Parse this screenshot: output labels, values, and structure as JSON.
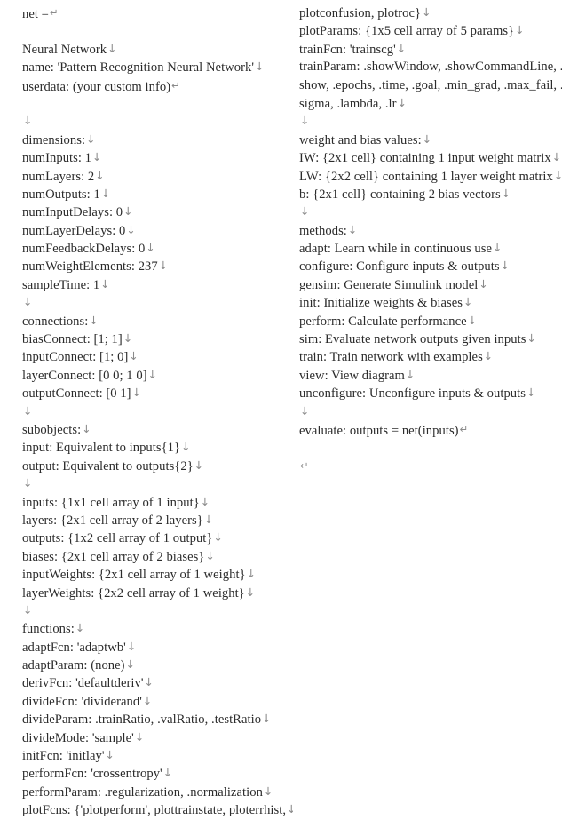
{
  "document": {
    "kind": "matlab-network-object-printout",
    "background_color": "#ffffff",
    "text_color": "#2b2b2b",
    "mark_color": "#8a8a8a",
    "marks": {
      "line_break": "↓",
      "paragraph": "↵"
    },
    "left_column": [
      {
        "text": "net =",
        "mark": "paragraph"
      },
      {
        "text": "",
        "mark": "none"
      },
      {
        "text": "Neural Network",
        "mark": "break"
      },
      {
        "text": "name: 'Pattern Recognition Neural Network'",
        "mark": "break"
      },
      {
        "text": "userdata: (your custom info)",
        "mark": "paragraph"
      },
      {
        "text": "",
        "mark": "none"
      },
      {
        "text": "",
        "mark": "break"
      },
      {
        "text": "dimensions:",
        "mark": "break"
      },
      {
        "text": "numInputs: 1",
        "mark": "break"
      },
      {
        "text": "numLayers: 2",
        "mark": "break"
      },
      {
        "text": "numOutputs: 1",
        "mark": "break"
      },
      {
        "text": "numInputDelays: 0",
        "mark": "break"
      },
      {
        "text": "numLayerDelays: 0",
        "mark": "break"
      },
      {
        "text": "numFeedbackDelays: 0",
        "mark": "break"
      },
      {
        "text": "numWeightElements: 237",
        "mark": "break"
      },
      {
        "text": "sampleTime: 1",
        "mark": "break"
      },
      {
        "text": "",
        "mark": "break"
      },
      {
        "text": "connections:",
        "mark": "break"
      },
      {
        "text": "biasConnect: [1; 1]",
        "mark": "break"
      },
      {
        "text": "inputConnect: [1; 0]",
        "mark": "break"
      },
      {
        "text": "layerConnect: [0 0; 1 0]",
        "mark": "break"
      },
      {
        "text": "outputConnect: [0 1]",
        "mark": "break"
      },
      {
        "text": "",
        "mark": "break"
      },
      {
        "text": "subobjects:",
        "mark": "break"
      },
      {
        "text": "input: Equivalent to inputs{1}",
        "mark": "break"
      },
      {
        "text": "output: Equivalent to outputs{2}",
        "mark": "break"
      },
      {
        "text": "",
        "mark": "break"
      },
      {
        "text": "inputs: {1x1 cell array of 1 input}",
        "mark": "break"
      },
      {
        "text": "layers: {2x1 cell array of 2 layers}",
        "mark": "break"
      },
      {
        "text": "outputs: {1x2 cell array of 1 output}",
        "mark": "break"
      },
      {
        "text": "biases: {2x1 cell array of 2 biases}",
        "mark": "break"
      },
      {
        "text": "inputWeights: {2x1 cell array of 1 weight}",
        "mark": "break"
      },
      {
        "text": "layerWeights: {2x2 cell array of 1 weight}",
        "mark": "break"
      },
      {
        "text": "",
        "mark": "break"
      },
      {
        "text": "functions:",
        "mark": "break"
      },
      {
        "text": "adaptFcn: 'adaptwb'",
        "mark": "break"
      },
      {
        "text": "adaptParam: (none)",
        "mark": "break"
      },
      {
        "text": "derivFcn: 'defaultderiv'",
        "mark": "break"
      },
      {
        "text": "divideFcn: 'dividerand'",
        "mark": "break"
      },
      {
        "text": "divideParam: .trainRatio, .valRatio, .testRatio",
        "mark": "break"
      },
      {
        "text": "divideMode: 'sample'",
        "mark": "break"
      },
      {
        "text": "initFcn: 'initlay'",
        "mark": "break"
      },
      {
        "text": "performFcn: 'crossentropy'",
        "mark": "break"
      },
      {
        "text": "performParam: .regularization, .normalization",
        "mark": "break"
      },
      {
        "text": "plotFcns: {'plotperform', plottrainstate, ploterrhist,",
        "mark": "break"
      }
    ],
    "right_column": [
      {
        "text": "plotconfusion, plotroc}",
        "mark": "break"
      },
      {
        "text": "plotParams: {1x5 cell array of 5 params}",
        "mark": "break"
      },
      {
        "text": "trainFcn: 'trainscg'",
        "mark": "break"
      },
      {
        "text": "trainParam: .showWindow, .showCommandLine, .",
        "mark": "none"
      },
      {
        "text": "show, .epochs, .time, .goal, .min_grad, .max_fail, .",
        "mark": "none"
      },
      {
        "text": "sigma, .lambda, .lr",
        "mark": "break"
      },
      {
        "text": "",
        "mark": "break"
      },
      {
        "text": "weight and bias values:",
        "mark": "break"
      },
      {
        "text": "IW: {2x1 cell} containing 1 input weight matrix",
        "mark": "break"
      },
      {
        "text": "LW: {2x2 cell} containing 1 layer weight matrix",
        "mark": "break"
      },
      {
        "text": "b: {2x1 cell} containing 2 bias vectors",
        "mark": "break"
      },
      {
        "text": "",
        "mark": "break"
      },
      {
        "text": "methods:",
        "mark": "break"
      },
      {
        "text": "adapt: Learn while in continuous use",
        "mark": "break"
      },
      {
        "text": "configure: Configure inputs & outputs",
        "mark": "break"
      },
      {
        "text": "gensim: Generate Simulink model",
        "mark": "break"
      },
      {
        "text": "init: Initialize weights & biases",
        "mark": "break"
      },
      {
        "text": "perform: Calculate performance",
        "mark": "break"
      },
      {
        "text": "sim: Evaluate network outputs given inputs",
        "mark": "break"
      },
      {
        "text": "train: Train network with examples",
        "mark": "break"
      },
      {
        "text": "view: View diagram",
        "mark": "break"
      },
      {
        "text": "unconfigure: Unconfigure inputs & outputs",
        "mark": "break"
      },
      {
        "text": "",
        "mark": "break"
      },
      {
        "text": "evaluate: outputs = net(inputs)",
        "mark": "paragraph"
      },
      {
        "text": "",
        "mark": "none"
      },
      {
        "text": "",
        "mark": "paragraph"
      }
    ]
  }
}
